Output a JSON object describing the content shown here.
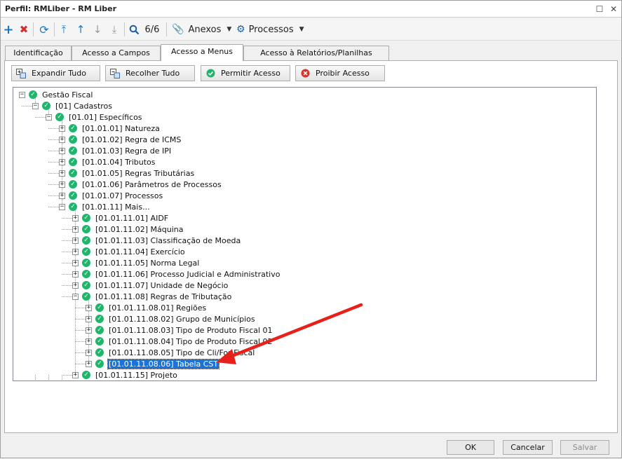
{
  "window": {
    "title": "Perfil: RMLiber - RM Liber"
  },
  "toolbar": {
    "record_counter": "6/6",
    "anexos_label": "Anexos",
    "processos_label": "Processos"
  },
  "tabs": [
    {
      "label": "Identificação"
    },
    {
      "label": "Acesso a Campos"
    },
    {
      "label": "Acesso a Menus"
    },
    {
      "label": "Acesso à Relatórios/Planilhas"
    }
  ],
  "actions": {
    "expand_all": "Expandir Tudo",
    "collapse_all": "Recolher Tudo",
    "allow": "Permitir Acesso",
    "deny": "Proibir Acesso"
  },
  "tree": [
    {
      "label": "Gestão Fiscal",
      "level": 0,
      "expanded": true
    },
    {
      "label": "[01] Cadastros",
      "level": 1,
      "expanded": true
    },
    {
      "label": "[01.01] Específicos",
      "level": 2,
      "expanded": true
    },
    {
      "label": "[01.01.01] Natureza",
      "level": 3,
      "expanded": false
    },
    {
      "label": "[01.01.02] Regra de ICMS",
      "level": 3,
      "expanded": false
    },
    {
      "label": "[01.01.03] Regra de IPI",
      "level": 3,
      "expanded": false
    },
    {
      "label": "[01.01.04] Tributos",
      "level": 3,
      "expanded": false
    },
    {
      "label": "[01.01.05] Regras Tributárias",
      "level": 3,
      "expanded": false
    },
    {
      "label": "[01.01.06] Parâmetros de Processos",
      "level": 3,
      "expanded": false
    },
    {
      "label": "[01.01.07] Processos",
      "level": 3,
      "expanded": false
    },
    {
      "label": "[01.01.11] Mais...",
      "level": 3,
      "expanded": true
    },
    {
      "label": "[01.01.11.01] AIDF",
      "level": 4,
      "expanded": false
    },
    {
      "label": "[01.01.11.02] Máquina",
      "level": 4,
      "expanded": false
    },
    {
      "label": "[01.01.11.03] Classificação de Moeda",
      "level": 4,
      "expanded": false
    },
    {
      "label": "[01.01.11.04] Exercício",
      "level": 4,
      "expanded": false
    },
    {
      "label": "[01.01.11.05] Norma Legal",
      "level": 4,
      "expanded": false
    },
    {
      "label": "[01.01.11.06] Processo Judicial e Administrativo",
      "level": 4,
      "expanded": false
    },
    {
      "label": "[01.01.11.07] Unidade de Negócio",
      "level": 4,
      "expanded": false
    },
    {
      "label": "[01.01.11.08] Regras de Tributação",
      "level": 4,
      "expanded": true
    },
    {
      "label": "[01.01.11.08.01] Regiões",
      "level": 5,
      "expanded": false
    },
    {
      "label": "[01.01.11.08.02] Grupo de Municípios",
      "level": 5,
      "expanded": false
    },
    {
      "label": "[01.01.11.08.03] Tipo de Produto Fiscal 01",
      "level": 5,
      "expanded": false
    },
    {
      "label": "[01.01.11.08.04] Tipo de Produto Fiscal 02",
      "level": 5,
      "expanded": false
    },
    {
      "label": "[01.01.11.08.05] Tipo de Cli/For Fiscal",
      "level": 5,
      "expanded": false
    },
    {
      "label": "[01.01.11.08.06] Tabela CST",
      "level": 5,
      "expanded": false,
      "selected": true
    },
    {
      "label": "[01.01.11.15] Projeto",
      "level": 4,
      "expanded": false
    }
  ],
  "footer": {
    "ok": "OK",
    "cancel": "Cancelar",
    "save": "Salvar"
  },
  "colors": {
    "check_green": "#1fb56b",
    "selection_blue": "#1a73d9",
    "annotation_red": "#e8201c"
  }
}
